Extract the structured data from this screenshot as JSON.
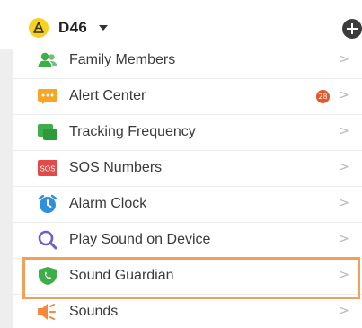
{
  "header": {
    "device_name": "D46",
    "device_icon": "yellow-device-avatar-icon",
    "dropdown_icon": "caret-down-icon",
    "add_icon": "plus-circle-icon"
  },
  "menu": {
    "chevron_glyph": ">",
    "items": [
      {
        "label": "Family Members",
        "icon": "family-members-icon",
        "icon_color": "#3fae4a"
      },
      {
        "label": "Alert Center",
        "icon": "alert-chat-icon",
        "icon_color": "#f5a623",
        "badge": "28"
      },
      {
        "label": "Tracking Frequency",
        "icon": "tracking-frequency-icon",
        "icon_color": "#3fae4a"
      },
      {
        "label": "SOS Numbers",
        "icon": "sos-icon",
        "icon_color": "#e24a4a",
        "icon_text": "SOS"
      },
      {
        "label": "Alarm Clock",
        "icon": "alarm-clock-icon",
        "icon_color": "#2f8fdc"
      },
      {
        "label": "Play Sound on Device",
        "icon": "search-magnifier-icon",
        "icon_color": "#6a5fd0"
      },
      {
        "label": "Sound Guardian",
        "icon": "shield-phone-icon",
        "icon_color": "#3fae4a",
        "highlighted": true
      },
      {
        "label": "Sounds",
        "icon": "speaker-icon",
        "icon_color": "#f5883a"
      }
    ]
  },
  "colors": {
    "highlight_border": "#f0a05a",
    "badge_bg": "#e2572e",
    "gutter": "#eeeeee"
  }
}
